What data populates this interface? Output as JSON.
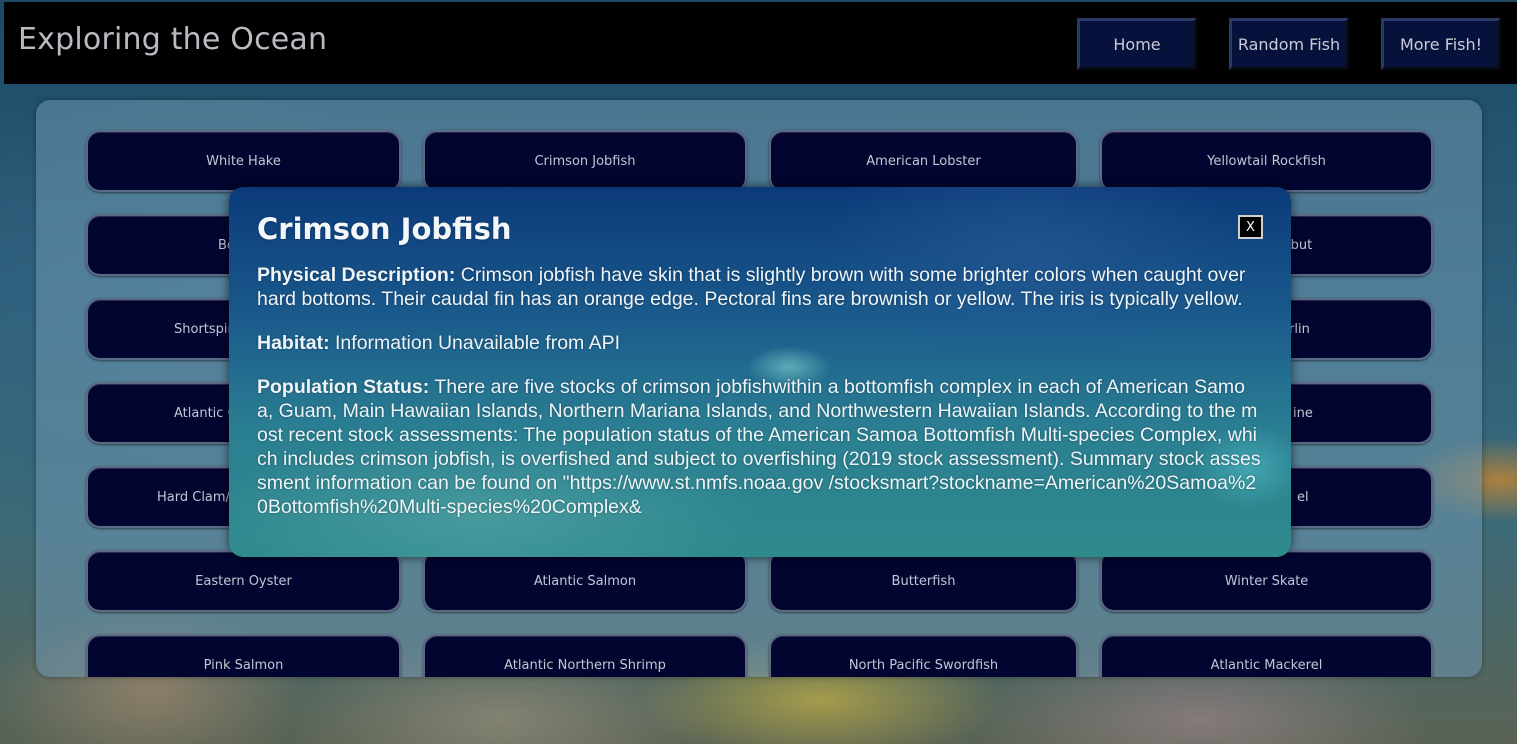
{
  "header": {
    "title": "Exploring the Ocean",
    "nav": [
      {
        "label": "Home"
      },
      {
        "label": "Random Fish"
      },
      {
        "label": "More Fish!"
      }
    ]
  },
  "grid": {
    "row1": [
      "White Hake",
      "Crimson Jobfish",
      "American Lobster",
      "Yellowtail Rockfish"
    ],
    "row2": [
      "Bo",
      "",
      "",
      "ibut"
    ],
    "row3": [
      "Shortspir",
      "",
      "",
      "rlin"
    ],
    "row4": [
      "Atlantic C",
      "",
      "",
      "ine"
    ],
    "row5": [
      "Hard Clam/N",
      "",
      "",
      "el"
    ],
    "row6": [
      "Eastern Oyster",
      "Atlantic Salmon",
      "Butterfish",
      "Winter Skate"
    ],
    "row7": [
      "Pink Salmon",
      "Atlantic Northern Shrimp",
      "North Pacific Swordfish",
      "Atlantic Mackerel"
    ]
  },
  "modal": {
    "title": "Crimson Jobfish",
    "close_label": "X",
    "physical_label": "Physical Description:",
    "physical_text": " Crimson jobfish have skin that is slightly brown with some brighter colors when caught over hard bottoms. Their caudal fin has an orange edge. Pectoral fins are brownish or yellow. The iris is typically yellow.",
    "habitat_label": "Habitat:",
    "habitat_text": " Information Unavailable from API",
    "population_label": "Population Status:",
    "population_text": " There are five stocks of crimson jobfishwithin a bottomfish complex in each of American Samoa, Guam, Main Hawaiian Islands, Northern Mariana Islands, and Northwestern Hawaiian Islands. According to the most recent stock assessments: The population status of the American Samoa Bottomfish Multi-species Complex, which includes crimson jobfish, is overfished and subject to overfishing (2019 stock assessment). Summary stock assessment information can be found on \"https://www.st.nmfs.noaa.gov /stocksmart?stockname=American%20Samoa%20Bottomfish%20Multi-species%20Complex&"
  }
}
